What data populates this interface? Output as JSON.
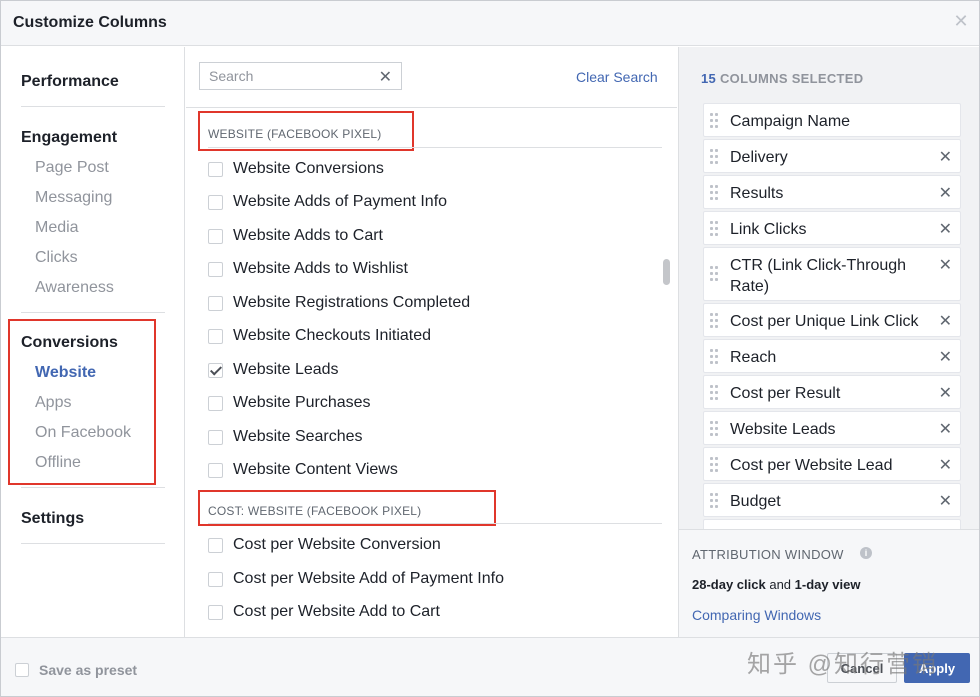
{
  "header": {
    "title": "Customize Columns",
    "close_glyph": "✕"
  },
  "nav": {
    "sections": [
      {
        "label": "Performance",
        "items": []
      },
      {
        "label": "Engagement",
        "items": [
          "Page Post",
          "Messaging",
          "Media",
          "Clicks",
          "Awareness"
        ]
      },
      {
        "label": "Conversions",
        "items": [
          "Website",
          "Apps",
          "On Facebook",
          "Offline"
        ],
        "active_item": "Website"
      },
      {
        "label": "Settings",
        "items": []
      }
    ]
  },
  "search": {
    "placeholder": "Search",
    "value": "",
    "clear_glyph": "✕",
    "clear_label": "Clear Search"
  },
  "groups": [
    {
      "heading": "WEBSITE (FACEBOOK PIXEL)",
      "options": [
        {
          "label": "Website Conversions",
          "checked": false
        },
        {
          "label": "Website Adds of Payment Info",
          "checked": false
        },
        {
          "label": "Website Adds to Cart",
          "checked": false
        },
        {
          "label": "Website Adds to Wishlist",
          "checked": false
        },
        {
          "label": "Website Registrations Completed",
          "checked": false
        },
        {
          "label": "Website Checkouts Initiated",
          "checked": false
        },
        {
          "label": "Website Leads",
          "checked": true
        },
        {
          "label": "Website Purchases",
          "checked": false
        },
        {
          "label": "Website Searches",
          "checked": false
        },
        {
          "label": "Website Content Views",
          "checked": false
        }
      ]
    },
    {
      "heading": "COST: WEBSITE (FACEBOOK PIXEL)",
      "options": [
        {
          "label": "Cost per Website Conversion",
          "checked": false
        },
        {
          "label": "Cost per Website Add of Payment Info",
          "checked": false
        },
        {
          "label": "Cost per Website Add to Cart",
          "checked": false
        }
      ]
    }
  ],
  "selected": {
    "count": "15",
    "count_label": "COLUMNS SELECTED",
    "remove_glyph": "✕",
    "columns": [
      {
        "label": "Campaign Name",
        "removable": false
      },
      {
        "label": "Delivery",
        "removable": true
      },
      {
        "label": "Results",
        "removable": true
      },
      {
        "label": "Link Clicks",
        "removable": true
      },
      {
        "label": "CTR (Link Click-Through Rate)",
        "removable": true
      },
      {
        "label": "Cost per Unique Link Click",
        "removable": true
      },
      {
        "label": "Reach",
        "removable": true
      },
      {
        "label": "Cost per Result",
        "removable": true
      },
      {
        "label": "Website Leads",
        "removable": true
      },
      {
        "label": "Cost per Website Lead",
        "removable": true
      },
      {
        "label": "Budget",
        "removable": true
      }
    ]
  },
  "attribution": {
    "heading": "ATTRIBUTION WINDOW",
    "click_window": "28-day click",
    "joiner": "and",
    "view_window": "1-day view",
    "link": "Comparing Windows"
  },
  "footer": {
    "save_preset": "Save as preset",
    "cancel": "Cancel",
    "apply": "Apply",
    "watermark": "知乎 @知行营销"
  },
  "colors": {
    "accent": "#4267b2",
    "highlight_box": "#e0362b"
  }
}
